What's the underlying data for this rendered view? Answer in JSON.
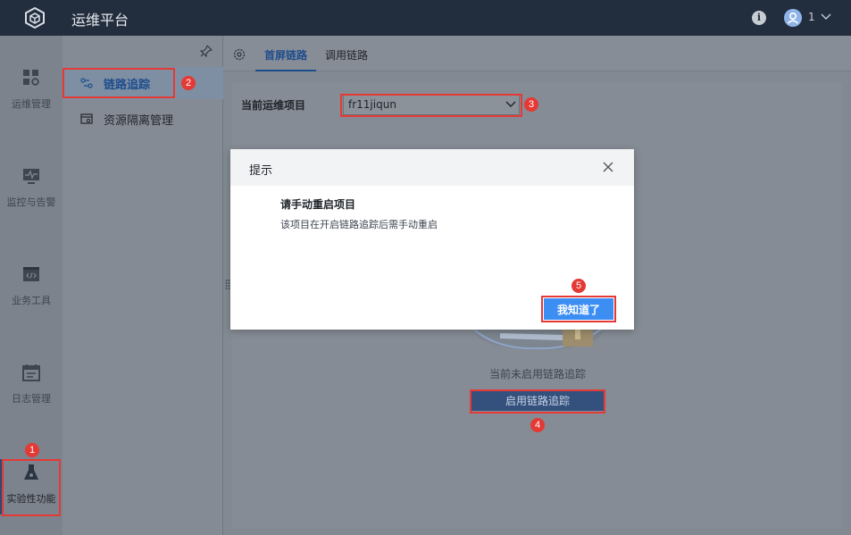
{
  "app": {
    "title": "运维平台",
    "logo_icon": "cube-logo-icon"
  },
  "header": {
    "info_icon": "info-icon",
    "user_name": "1",
    "user_icon": "user-avatar-icon",
    "chevron_icon": "chevron-down-icon"
  },
  "sidebar": {
    "items": [
      {
        "label": "运维管理",
        "icon": "grid-settings-icon"
      },
      {
        "label": "监控与告警",
        "icon": "monitor-pulse-icon"
      },
      {
        "label": "业务工具",
        "icon": "code-window-icon"
      },
      {
        "label": "日志管理",
        "icon": "calendar-log-icon"
      },
      {
        "label": "实验性功能",
        "icon": "flask-icon"
      }
    ]
  },
  "submenu": {
    "items": [
      {
        "label": "链路追踪",
        "icon": "trace-route-icon"
      },
      {
        "label": "资源隔离管理",
        "icon": "resource-isolation-icon"
      }
    ]
  },
  "tabs": [
    {
      "label": "首屏链路"
    },
    {
      "label": "调用链路"
    }
  ],
  "form": {
    "project_label": "当前运维项目",
    "project_value": "fr11jiqun"
  },
  "empty_state": {
    "text": "当前未启用链路追踪",
    "button_label": "启用链路追踪"
  },
  "modal": {
    "title": "提示",
    "heading": "请手动重启项目",
    "body": "该项目在开启链路追踪后需手动重启",
    "ok_label": "我知道了"
  },
  "annotations": [
    "1",
    "2",
    "3",
    "4",
    "5"
  ],
  "colors": {
    "topbar": "#222d3d",
    "accent": "#3d8ef3",
    "marker": "#e53935"
  }
}
